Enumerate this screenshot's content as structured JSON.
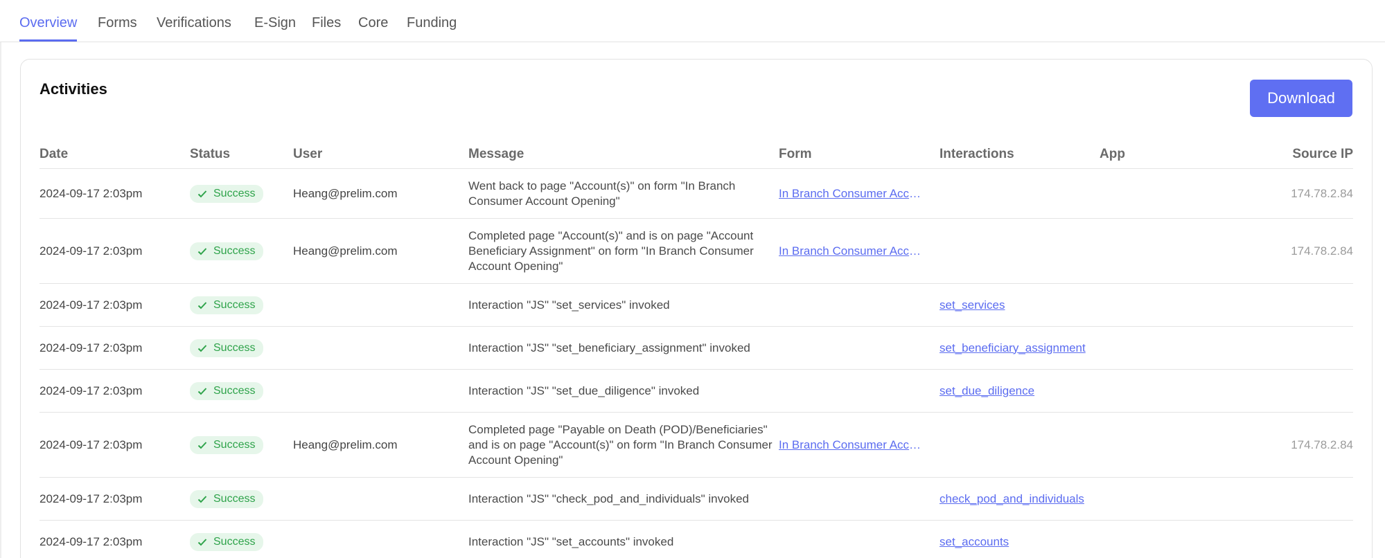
{
  "tabs": [
    {
      "label": "Overview"
    },
    {
      "label": "Forms"
    },
    {
      "label": "Verifications"
    },
    {
      "label": "E-Sign"
    },
    {
      "label": "Files"
    },
    {
      "label": "Core"
    },
    {
      "label": "Funding"
    }
  ],
  "activities": {
    "title": "Activities",
    "download_label": "Download",
    "columns": {
      "date": "Date",
      "status": "Status",
      "user": "User",
      "message": "Message",
      "form": "Form",
      "interactions": "Interactions",
      "app": "App",
      "source_ip": "Source IP"
    },
    "rows": [
      {
        "date": "2024-09-17 2:03pm",
        "status": "Success",
        "user": "Heang@prelim.com",
        "message": "Went back to page \"Account(s)\" on form \"In Branch Consumer Account Opening\"",
        "form": "In Branch Consumer Acco...",
        "interaction": "",
        "app": "",
        "ip": "174.78.2.84"
      },
      {
        "date": "2024-09-17 2:03pm",
        "status": "Success",
        "user": "Heang@prelim.com",
        "message": "Completed page \"Account(s)\" and is on page \"Account Beneficiary Assignment\" on form \"In Branch Consumer Account Opening\"",
        "form": "In Branch Consumer Acco...",
        "interaction": "",
        "app": "",
        "ip": "174.78.2.84"
      },
      {
        "date": "2024-09-17 2:03pm",
        "status": "Success",
        "user": "",
        "message": "Interaction \"JS\" \"set_services\" invoked",
        "form": "",
        "interaction": "set_services",
        "app": "",
        "ip": ""
      },
      {
        "date": "2024-09-17 2:03pm",
        "status": "Success",
        "user": "",
        "message": "Interaction \"JS\" \"set_beneficiary_assignment\" invoked",
        "form": "",
        "interaction": "set_beneficiary_assignment",
        "app": "",
        "ip": ""
      },
      {
        "date": "2024-09-17 2:03pm",
        "status": "Success",
        "user": "",
        "message": "Interaction \"JS\" \"set_due_diligence\" invoked",
        "form": "",
        "interaction": "set_due_diligence",
        "app": "",
        "ip": ""
      },
      {
        "date": "2024-09-17 2:03pm",
        "status": "Success",
        "user": "Heang@prelim.com",
        "message": "Completed page \"Payable on Death (POD)/Beneficiaries\" and is on page \"Account(s)\" on form \"In Branch Consumer Account Opening\"",
        "form": "In Branch Consumer Acco...",
        "interaction": "",
        "app": "",
        "ip": "174.78.2.84"
      },
      {
        "date": "2024-09-17 2:03pm",
        "status": "Success",
        "user": "",
        "message": "Interaction \"JS\" \"check_pod_and_individuals\" invoked",
        "form": "",
        "interaction": "check_pod_and_individuals",
        "app": "",
        "ip": ""
      },
      {
        "date": "2024-09-17 2:03pm",
        "status": "Success",
        "user": "",
        "message": "Interaction \"JS\" \"set_accounts\" invoked",
        "form": "",
        "interaction": "set_accounts",
        "app": "",
        "ip": ""
      }
    ]
  },
  "colors": {
    "accent": "#5b6cf0",
    "button": "#5f6ff2",
    "success_bg": "#e6f6ea",
    "success_text": "#2ea34a"
  },
  "icons": {
    "status": "check-icon"
  }
}
